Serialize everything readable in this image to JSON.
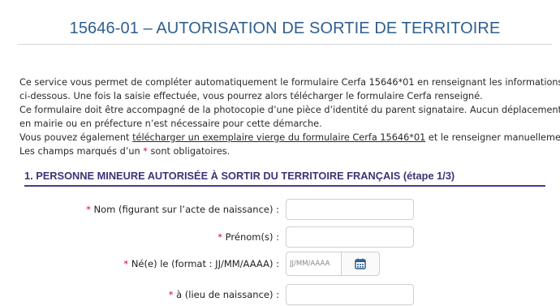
{
  "page": {
    "title": "15646-01 – AUTORISATION DE SORTIE DE TERRITOIRE"
  },
  "intro": {
    "line1": "Ce service vous permet de compléter automatiquement le formulaire Cerfa 15646*01 en renseignant les informations",
    "line2": "ci-dessous. Une fois la saisie effectuée, vous pourrez alors télécharger le formulaire Cerfa renseigné.",
    "line3": "Ce formulaire doit être accompagné de la photocopie d’une pièce d’identité du parent signataire. Aucun déplacement",
    "line4": "en mairie ou en préfecture n’est nécessaire pour cette démarche.",
    "line5_before": "Vous pouvez également ",
    "line5_link": "télécharger un exemplaire vierge du formulaire Cerfa 15646*01",
    "line5_after": " et le renseigner manuellement",
    "line6_before": "Les champs marqués d’un ",
    "line6_star": "*",
    "line6_after": " sont obligatoires."
  },
  "section1": {
    "title": "1. PERSONNE MINEURE AUTORISÉE À SORTIR DU TERRITOIRE FRANÇAIS (étape 1/3)"
  },
  "fields": {
    "required_mark": "*",
    "nom_label": " Nom (figurant sur l’acte de naissance) :",
    "nom_value": "",
    "prenoms_label": " Prénom(s) :",
    "prenoms_value": "",
    "date_label": " Né(e) le (format : JJ/MM/AAAA) :",
    "date_placeholder": "JJ/MM/AAAA",
    "lieu_label": " à (lieu de naissance) :",
    "lieu_value": ""
  },
  "icons": {
    "calendar": "calendar-icon"
  },
  "colors": {
    "title": "#2d5f8f",
    "section": "#3e3378",
    "section_rule": "#4b3c8c",
    "required": "#c8102e",
    "calendar": "#2e5f8e"
  }
}
